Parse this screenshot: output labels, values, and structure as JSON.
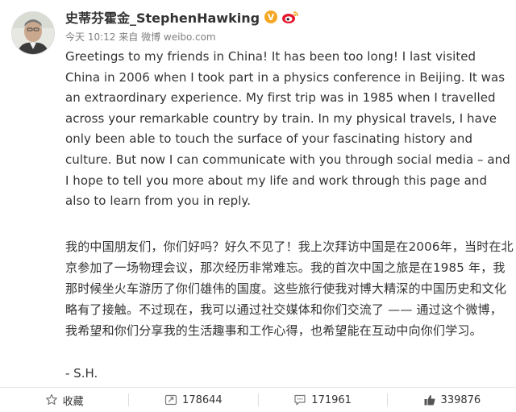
{
  "author": {
    "name": "史蒂芬霍金_StephenHawking",
    "verified_badge": "V"
  },
  "post": {
    "time": "今天 10:12",
    "source_prefix": "来自",
    "source": "微博 weibo.com",
    "text_en": "Greetings to my friends in China! It has been too long! I last visited China in 2006 when I took part in a physics conference in Beijing. It was an extraordinary experience. My first trip was in 1985 when I travelled across your remarkable country by train. In my physical travels, I have only been able to touch the surface of your fascinating history and culture. But now I can communicate with you through social media – and I hope to tell you more about my life and work through this page and also to learn from you in reply.",
    "text_cn": "我的中国朋友们，你们好吗？好久不见了！我上次拜访中国是在2006年，当时在北京参加了一场物理会议，那次经历非常难忘。我的首次中国之旅是在1985 年，我那时候坐火车游历了你们雄伟的国度。这些旅行使我对博大精深的中国历史和文化略有了接触。不过现在，我可以通过社交媒体和你们交流了 —— 通过这个微博，我希望和你们分享我的生活趣事和工作心得，也希望能在互动中向你们学习。",
    "signature": "- S.H."
  },
  "actions": {
    "favorite_label": "收藏",
    "repost_count": "178644",
    "comment_count": "171961",
    "like_count": "339876"
  },
  "icons": {
    "favorite": "star-icon",
    "repost": "repost-icon",
    "comment": "comment-icon",
    "like": "thumbs-up-icon",
    "brand": "weibo-logo-icon"
  },
  "colors": {
    "badge": "#f5a623",
    "weibo_red": "#e6162d",
    "text": "#333333",
    "meta": "#808080"
  }
}
